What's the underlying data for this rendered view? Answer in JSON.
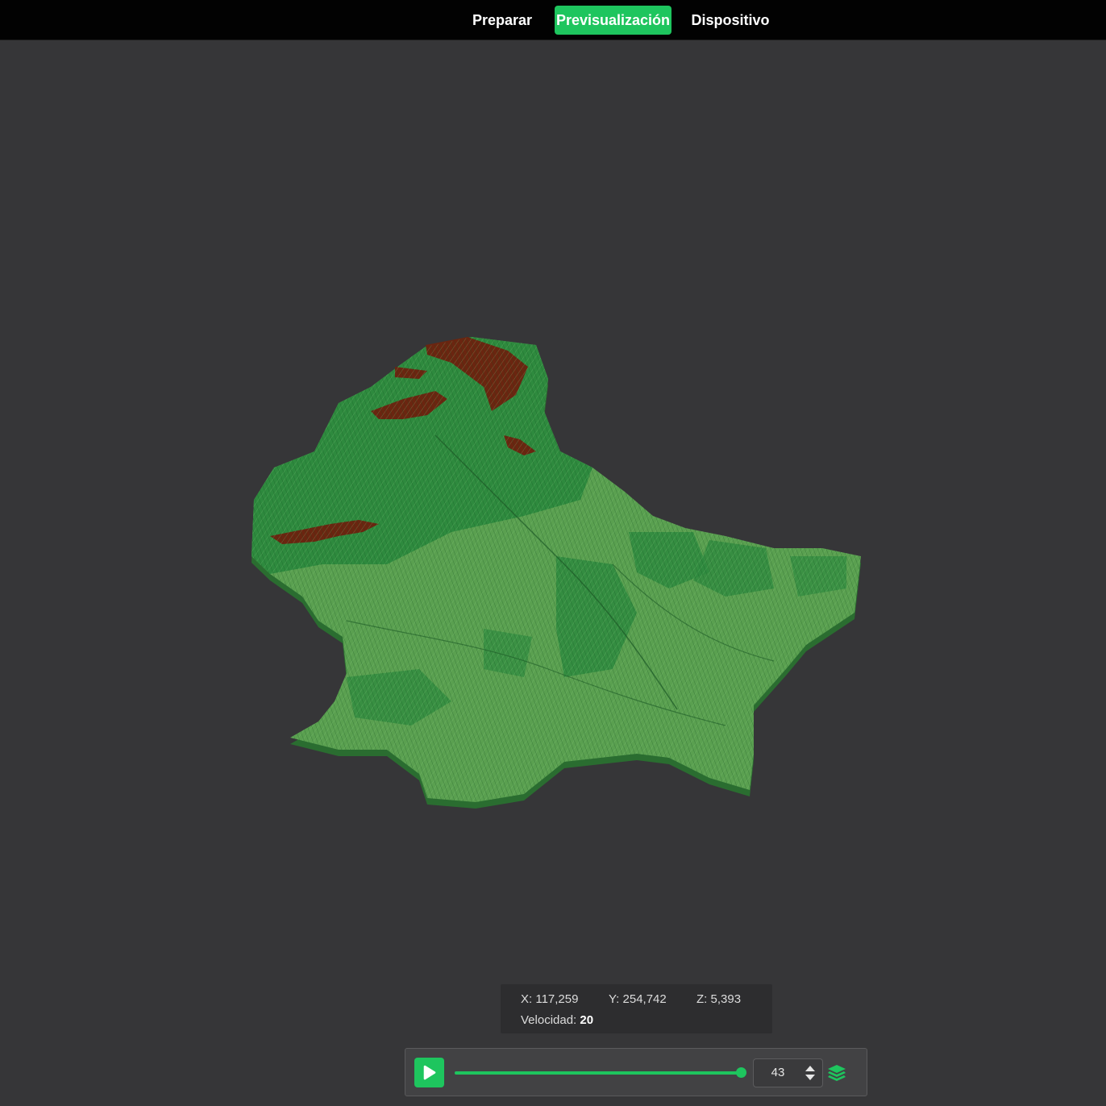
{
  "tabs": [
    {
      "label": "Preparar",
      "active": false
    },
    {
      "label": "Previsualización",
      "active": true
    },
    {
      "label": "Dispositivo",
      "active": false
    }
  ],
  "colors": {
    "accent": "#1ec55e",
    "background": "#363638",
    "topbar": "#020202",
    "terrain_low": "#5aa050",
    "terrain_mid": "#2e8a3e",
    "terrain_high": "#6b2510"
  },
  "viewport": {
    "model": "3d-terrain-relief-map",
    "icon": "terrain-model"
  },
  "coordinates": {
    "x": "X: 117,259",
    "y": "Y: 254,742",
    "z": "Z: 5,393",
    "speed_label": "Velocidad: ",
    "speed_value": "20"
  },
  "playback": {
    "play_icon": "play-icon",
    "layer": "43",
    "progress_percent": 100,
    "layers_icon": "layers-icon"
  }
}
